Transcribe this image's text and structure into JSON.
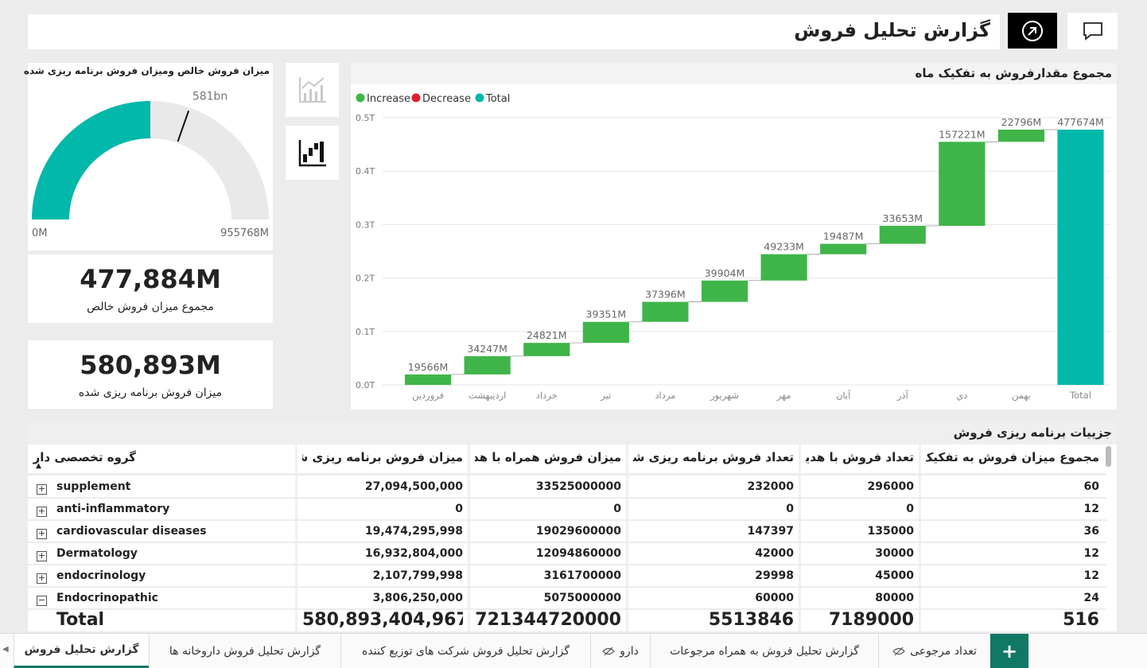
{
  "header": {
    "title": "گزارش تحلیل فروش"
  },
  "gauge": {
    "title": "میزان فروش خالص ومیزان فروش برنامه ریزی شده",
    "value": 477884,
    "target": 580893,
    "max": 955768,
    "min_label": "0M",
    "max_label": "955768M",
    "target_label": "581bn",
    "colors": {
      "fill": "#01b8aa",
      "track": "#e9e9e9",
      "needle": "#111111"
    }
  },
  "kpi_net": {
    "value": "477,884M",
    "label": "مجموع میزان فروش خالص"
  },
  "kpi_planned": {
    "value": "580,893M",
    "label": "میزان فروش برنامه ریزی شده"
  },
  "icons": {
    "line_chart": "line-chart-icon",
    "waterfall": "waterfall-chart-icon",
    "nav": "arrow-circle-icon",
    "comment": "comment-icon"
  },
  "chart_data": {
    "type": "waterfall",
    "title": "مجموع مقدارفروش به تفکیک ماه",
    "legend": {
      "position": "top-left",
      "items": [
        {
          "name": "Increase",
          "color": "#3fb549"
        },
        {
          "name": "Decrease",
          "color": "#e0202e"
        },
        {
          "name": "Total",
          "color": "#01b8aa"
        }
      ]
    },
    "categories": [
      "فروردین",
      "اردیبهشت",
      "خرداد",
      "تیر",
      "مرداد",
      "شهریور",
      "مهر",
      "آبان",
      "آذر",
      "دي",
      "بهمن",
      "Total"
    ],
    "values": [
      19566,
      34247,
      24821,
      39351,
      37396,
      39904,
      49233,
      19487,
      33653,
      157221,
      22796,
      477674
    ],
    "value_labels": [
      "19566M",
      "34247M",
      "24821M",
      "39351M",
      "37396M",
      "39904M",
      "49233M",
      "19487M",
      "33653M",
      "157221M",
      "22796M",
      "477674M"
    ],
    "y_ticks": [
      "0.0T",
      "0.1T",
      "0.2T",
      "0.3T",
      "0.4T",
      "0.5T"
    ],
    "ylim": [
      0,
      500000
    ],
    "grid": true
  },
  "table": {
    "title": "جزییات برنامه ریزی فروش",
    "columns": [
      "گروه تخصصی دارو",
      "میزان فروش برنامه ریزی شده",
      "میزان فروش همراه با هدیه",
      "تعداد فروش برنامه ریزی شده",
      "تعداد فروش با هدیه",
      "مجموع میزان فروش به تفکیک ماه"
    ],
    "rows": [
      {
        "expand": "+",
        "group": "supplement",
        "planned_amount": "27,094,500,000",
        "gift_amount": "33525000000",
        "planned_count": "232000",
        "gift_count": "296000",
        "months": "60"
      },
      {
        "expand": "+",
        "group": "anti-inflammatory",
        "planned_amount": "0",
        "gift_amount": "0",
        "planned_count": "0",
        "gift_count": "0",
        "months": "12"
      },
      {
        "expand": "+",
        "group": "cardiovascular diseases",
        "planned_amount": "19,474,295,998",
        "gift_amount": "19029600000",
        "planned_count": "147397",
        "gift_count": "135000",
        "months": "36"
      },
      {
        "expand": "+",
        "group": "Dermatology",
        "planned_amount": "16,932,804,000",
        "gift_amount": "12094860000",
        "planned_count": "42000",
        "gift_count": "30000",
        "months": "12"
      },
      {
        "expand": "+",
        "group": "endocrinology",
        "planned_amount": "2,107,799,998",
        "gift_amount": "3161700000",
        "planned_count": "29998",
        "gift_count": "45000",
        "months": "12"
      },
      {
        "expand": "−",
        "group": "Endocrinopathic",
        "planned_amount": "3,806,250,000",
        "gift_amount": "5075000000",
        "planned_count": "60000",
        "gift_count": "80000",
        "months": "24"
      }
    ],
    "total": {
      "label": "Total",
      "planned_amount": "580,893,404,967",
      "gift_amount": "721344720000",
      "planned_count": "5513846",
      "gift_count": "7189000",
      "months": "516"
    }
  },
  "tabs": [
    {
      "label": "گزارش تحلیل فروش",
      "active": true,
      "hidden": false
    },
    {
      "label": "گزارش تحلیل فروش داروخانه ها",
      "active": false,
      "hidden": false
    },
    {
      "label": "گزارش تحلیل فروش شرکت های توزیع کننده",
      "active": false,
      "hidden": false
    },
    {
      "label": "دارو",
      "active": false,
      "hidden": true
    },
    {
      "label": "گزارش تحلیل فروش به همراه مرجوعات",
      "active": false,
      "hidden": false
    },
    {
      "label": "تعداد مرجوعی",
      "active": false,
      "hidden": true
    }
  ],
  "add_tab_label": "+"
}
